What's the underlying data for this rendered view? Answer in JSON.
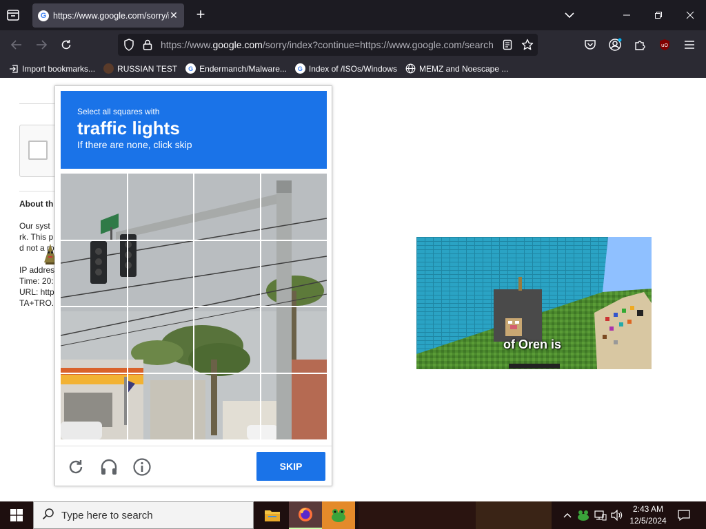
{
  "browser": {
    "tab": {
      "favicon_letter": "G",
      "title": "https://www.google.com/sorry/index?continue",
      "close_glyph": "✕"
    },
    "new_tab_glyph": "+",
    "url": {
      "prefix": "https://www.",
      "domain": "google.com",
      "path": "/sorry/index?continue=https://www.google.com/search"
    },
    "bookmarks": [
      {
        "label": "Import bookmarks...",
        "icon": "import-icon"
      },
      {
        "label": "RUSSIAN TEST",
        "icon": "horse-icon"
      },
      {
        "label": "Endermanch/Malware...",
        "icon": "google-icon"
      },
      {
        "label": "Index of /ISOs/Windows",
        "icon": "google-icon"
      },
      {
        "label": "MEMZ and Noescape ...",
        "icon": "globe-icon"
      }
    ]
  },
  "page": {
    "about_title": "About th",
    "about_text": "Our syst\nrk. This p\nd not a ro",
    "ip_text": "IP addres\nTime: 20:\nURL: http\nTA+TRO..."
  },
  "captcha": {
    "instruction": "Select all squares with",
    "target": "traffic lights",
    "hint": "If there are none, click skip",
    "skip_label": "SKIP",
    "grid_rows": 4,
    "grid_cols": 4
  },
  "video": {
    "caption": "of Oren is"
  },
  "taskbar": {
    "search_placeholder": "Type here to search",
    "time": "2:43 AM",
    "date": "12/5/2024"
  },
  "colors": {
    "captcha_blue": "#1a73e8",
    "tab_bg": "#42414d",
    "toolbar_bg": "#2b2a33",
    "titlebar_bg": "#1c1b22"
  }
}
